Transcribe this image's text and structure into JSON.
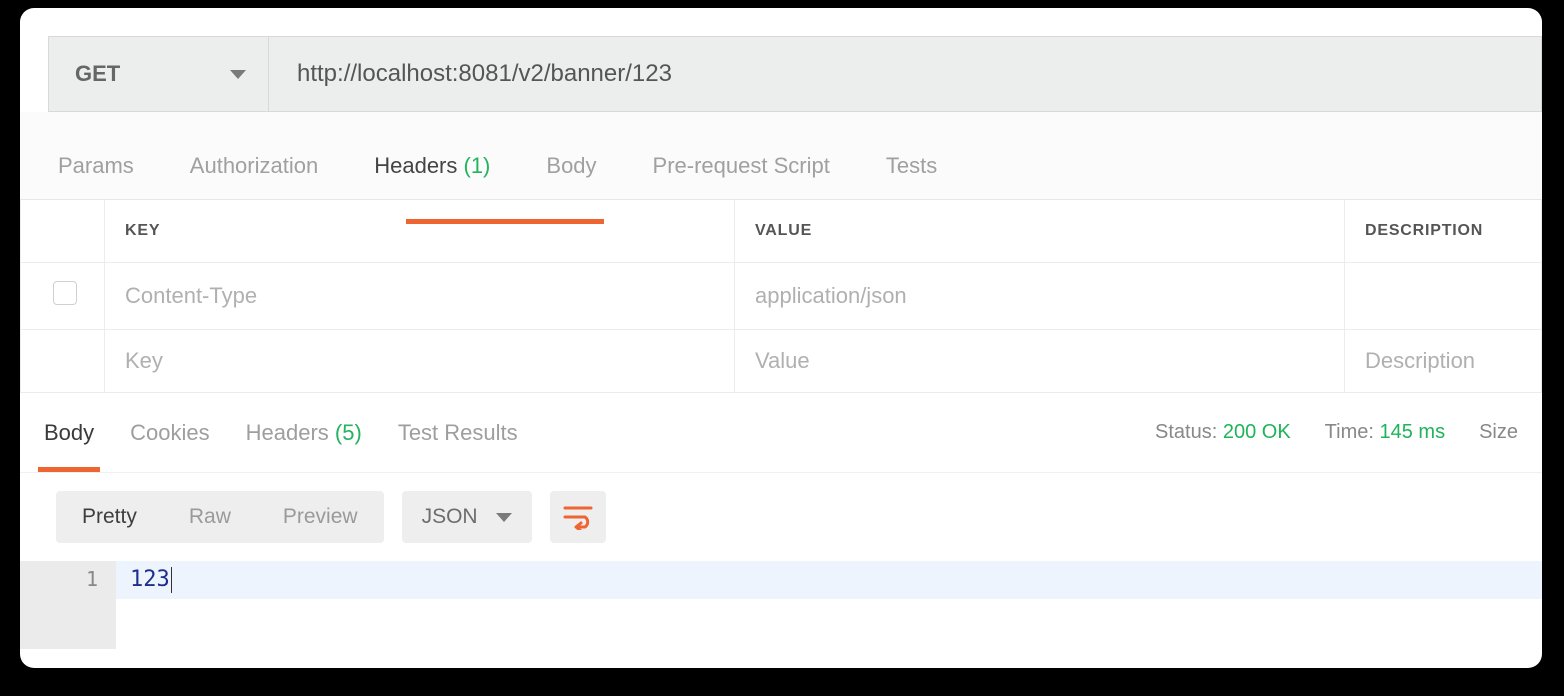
{
  "request": {
    "method": "GET",
    "url": "http://localhost:8081/v2/banner/123",
    "tabs": [
      {
        "label": "Params"
      },
      {
        "label": "Authorization"
      },
      {
        "label": "Headers",
        "count": "(1)",
        "active": true
      },
      {
        "label": "Body"
      },
      {
        "label": "Pre-request Script"
      },
      {
        "label": "Tests"
      }
    ],
    "header_table": {
      "columns": {
        "key": "KEY",
        "value": "VALUE",
        "desc": "DESCRIPTION"
      },
      "rows": [
        {
          "key": "Content-Type",
          "value": "application/json",
          "desc": ""
        }
      ],
      "placeholder": {
        "key": "Key",
        "value": "Value",
        "desc": "Description"
      }
    }
  },
  "response": {
    "tabs": [
      {
        "label": "Body",
        "active": true
      },
      {
        "label": "Cookies"
      },
      {
        "label": "Headers",
        "count": "(5)"
      },
      {
        "label": "Test Results"
      }
    ],
    "status_label": "Status:",
    "status_value": "200 OK",
    "time_label": "Time:",
    "time_value": "145 ms",
    "size_label": "Size",
    "body_toolbar": {
      "view_modes": [
        "Pretty",
        "Raw",
        "Preview"
      ],
      "active_mode": "Pretty",
      "format": "JSON"
    },
    "body_lines": [
      {
        "n": "1",
        "text": "123"
      }
    ]
  }
}
